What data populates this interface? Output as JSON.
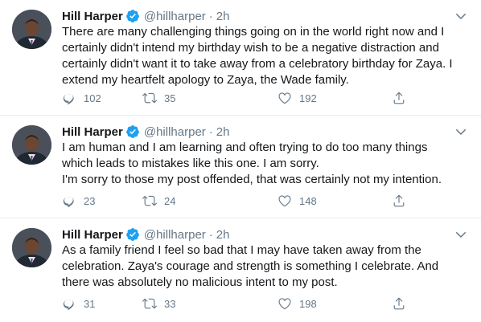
{
  "tweets": [
    {
      "author": "Hill Harper",
      "handle": "@hillharper",
      "separator": "·",
      "time": "2h",
      "text": "There are many challenging things going on in the world right now and I\ncertainly didn't intend my birthday wish to be a negative distraction and\ncertainly didn't want it to take away from a celebratory birthday for Zaya. I\nextend my heartfelt apology to Zaya, the Wade family.",
      "replies": "102",
      "retweets": "35",
      "likes": "192"
    },
    {
      "author": "Hill Harper",
      "handle": "@hillharper",
      "separator": "·",
      "time": "2h",
      "text": "I am human and I am learning and often trying to do too many things\nwhich leads to mistakes like this one. I am sorry.\nI'm sorry to those my post offended, that was certainly not my intention.",
      "replies": "23",
      "retweets": "24",
      "likes": "148"
    },
    {
      "author": "Hill Harper",
      "handle": "@hillharper",
      "separator": "·",
      "time": "2h",
      "text": "As a family friend I feel so bad that I may have taken away from the\ncelebration. Zaya's courage and strength is something I celebrate. And\nthere was absolutely no malicious intent to my post.",
      "replies": "31",
      "retweets": "33",
      "likes": "198"
    }
  ],
  "icons": {
    "verified": "verified-badge-icon",
    "caret": "chevron-down-icon",
    "reply": "reply-icon",
    "retweet": "retweet-icon",
    "like": "heart-icon",
    "share": "share-icon"
  },
  "colors": {
    "text": "#14171a",
    "secondary": "#657786",
    "verified": "#1da1f2",
    "divider": "#e6ecf0"
  }
}
